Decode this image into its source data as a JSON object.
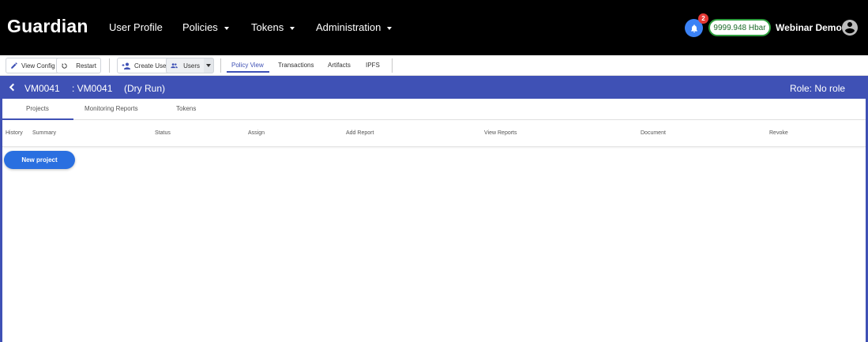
{
  "topbar": {
    "brand": "Guardian",
    "nav": [
      {
        "label": "User Profile",
        "has_menu": false
      },
      {
        "label": "Policies",
        "has_menu": true
      },
      {
        "label": "Tokens",
        "has_menu": true
      },
      {
        "label": "Administration",
        "has_menu": true
      }
    ],
    "notification_count": "2",
    "balance": "9999.948 Hbar",
    "username": "Webinar Demo"
  },
  "toolbar": {
    "view_config": "View Config",
    "restart": "Restart",
    "create_user": "Create User",
    "users": "Users",
    "links": [
      "Policy View",
      "Transactions",
      "Artifacts",
      "IPFS"
    ],
    "active_link": "Policy View"
  },
  "policy": {
    "code": "VM0041",
    "subtitle": ": VM0041",
    "mode": "(Dry Run)",
    "role": "Role: No role"
  },
  "tabs": [
    "Projects",
    "Monitoring Reports",
    "Tokens"
  ],
  "active_tab": "Projects",
  "table": {
    "columns": [
      "History",
      "Summary",
      "Status",
      "Assign",
      "Add Report",
      "View Reports",
      "Document",
      "Revoke"
    ],
    "rows": []
  },
  "new_project_label": "New project",
  "colors": {
    "accent": "#3f51b5",
    "primary_button": "#2a6fe0",
    "balance_border": "#2e9e3e",
    "badge": "#e53935"
  }
}
